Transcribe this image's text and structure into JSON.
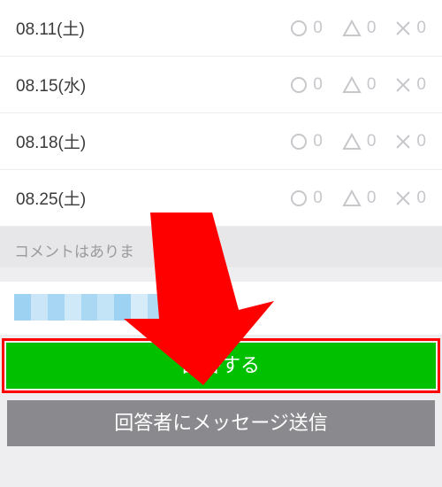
{
  "dates": [
    {
      "label": "08.11(土)",
      "circle": 0,
      "triangle": 0,
      "cross": 0
    },
    {
      "label": "08.15(水)",
      "circle": 0,
      "triangle": 0,
      "cross": 0
    },
    {
      "label": "08.18(土)",
      "circle": 0,
      "triangle": 0,
      "cross": 0
    },
    {
      "label": "08.25(土)",
      "circle": 0,
      "triangle": 0,
      "cross": 0
    }
  ],
  "comment_placeholder": "コメントはありま",
  "buttons": {
    "respond": "回答する",
    "message": "回答者にメッセージ送信"
  },
  "pix_colors": [
    "#9ed2f2",
    "#c9e5f7",
    "#a6d6f3",
    "#cfe9f8",
    "#aad8f3",
    "#c3e3f7",
    "#9ed2f2",
    "#d6ecf9",
    "#b0daf4"
  ]
}
